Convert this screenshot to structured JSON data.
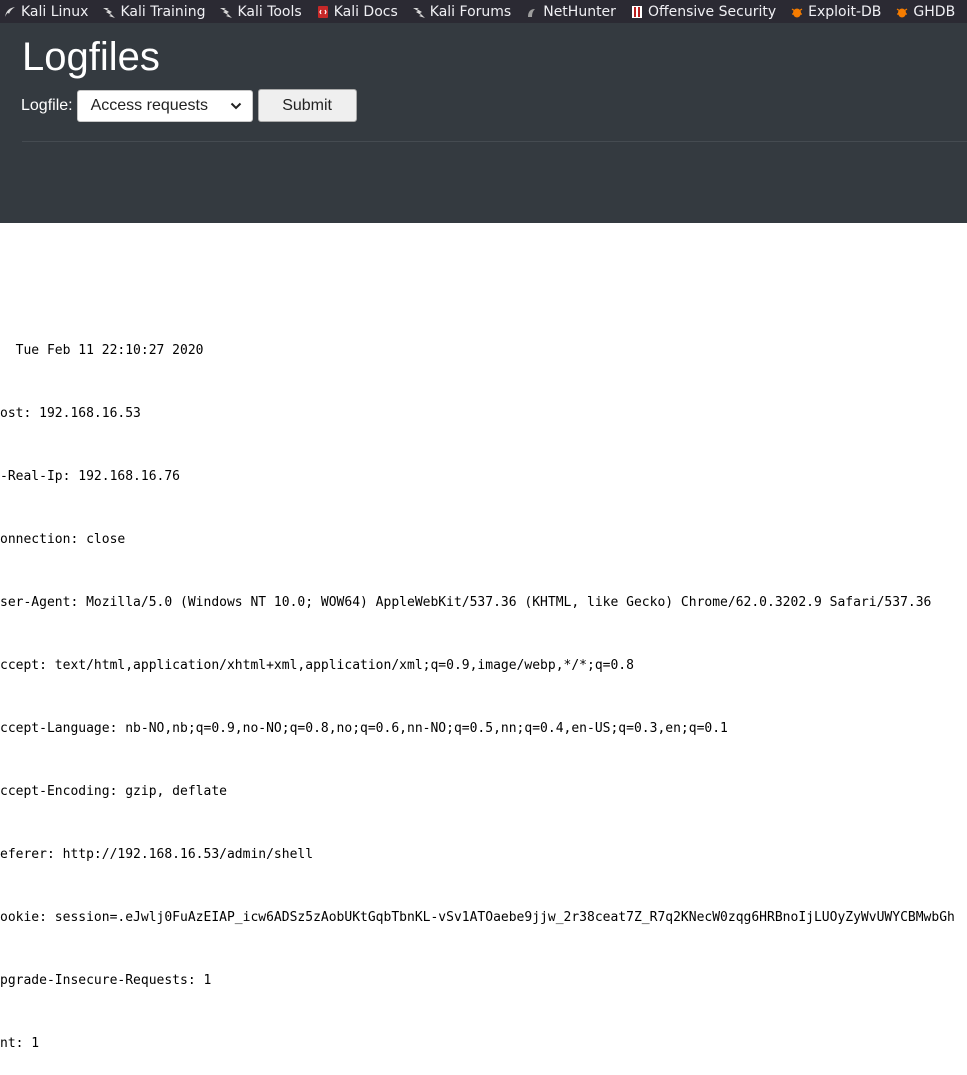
{
  "bookmarks": [
    {
      "label": "Kali Linux",
      "icon": "kali-dragon-icon"
    },
    {
      "label": "Kali Training",
      "icon": "kali-dragon-icon"
    },
    {
      "label": "Kali Tools",
      "icon": "kali-dragon-icon"
    },
    {
      "label": "Kali Docs",
      "icon": "docs-red-icon"
    },
    {
      "label": "Kali Forums",
      "icon": "kali-dragon-icon"
    },
    {
      "label": "NetHunter",
      "icon": "nethunter-icon"
    },
    {
      "label": "Offensive Security",
      "icon": "offsec-icon"
    },
    {
      "label": "Exploit-DB",
      "icon": "exploit-db-bug-icon"
    },
    {
      "label": "GHDB",
      "icon": "exploit-db-bug-icon"
    }
  ],
  "page": {
    "title": "Logfiles"
  },
  "form": {
    "label": "Logfile:",
    "selected": "Access requests",
    "submit_label": "Submit"
  },
  "log": {
    "lines": [
      "  Tue Feb 11 22:10:27 2020",
      "ost: 192.168.16.53",
      "-Real-Ip: 192.168.16.76",
      "onnection: close",
      "ser-Agent: Mozilla/5.0 (Windows NT 10.0; WOW64) AppleWebKit/537.36 (KHTML, like Gecko) Chrome/62.0.3202.9 Safari/537.36",
      "ccept: text/html,application/xhtml+xml,application/xml;q=0.9,image/webp,*/*;q=0.8",
      "ccept-Language: nb-NO,nb;q=0.9,no-NO;q=0.8,no;q=0.6,nn-NO;q=0.5,nn;q=0.4,en-US;q=0.3,en;q=0.1",
      "ccept-Encoding: gzip, deflate",
      "eferer: http://192.168.16.53/admin/shell",
      "ookie: session=.eJwlj0FuAzEIAP_icw6ADSz5zAobUKtGqbTbnKL-vSv1ATOaebe9jjw_2r38ceat7Z_R7q2KNecW0zqg6HRBnoIjLUOyZyWvUWYCBMwbGh",
      "pgrade-Insecure-Requests: 1",
      "nt: 1"
    ]
  },
  "colors": {
    "toolbar_bg": "#2b2a33",
    "header_bg": "#343a40",
    "page_bg": "#ffffff"
  }
}
